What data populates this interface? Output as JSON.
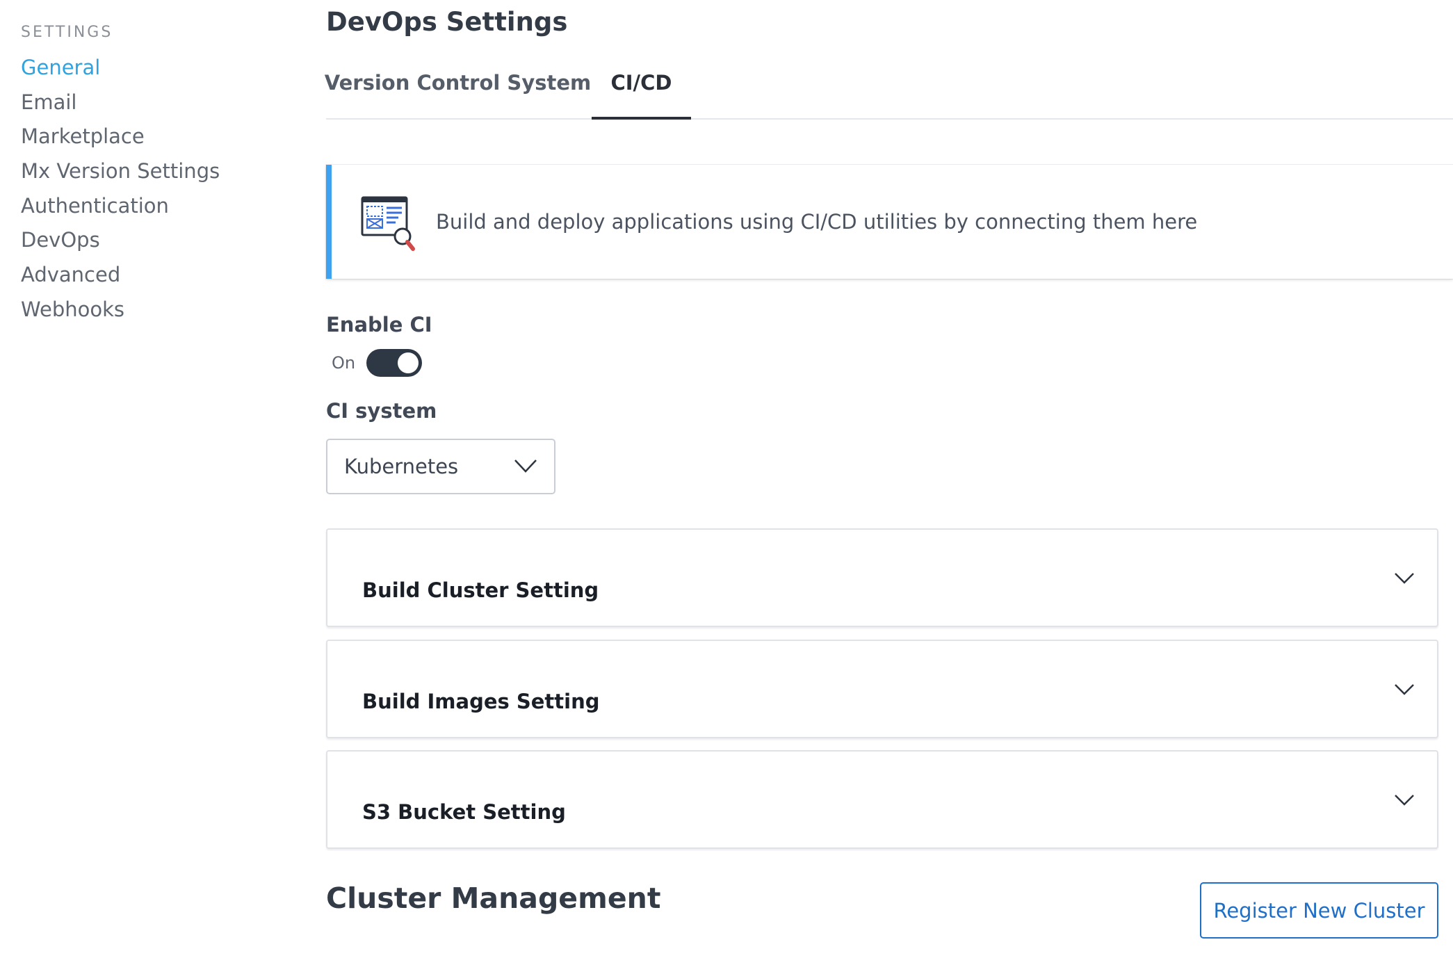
{
  "sidebar": {
    "heading": "SETTINGS",
    "items": [
      {
        "label": "General",
        "active": true
      },
      {
        "label": "Email"
      },
      {
        "label": "Marketplace"
      },
      {
        "label": "Mx Version Settings"
      },
      {
        "label": "Authentication"
      },
      {
        "label": "DevOps"
      },
      {
        "label": "Advanced"
      },
      {
        "label": "Webhooks"
      }
    ]
  },
  "header": {
    "title": "DevOps Settings"
  },
  "tabs": [
    {
      "label": "Version Control System"
    },
    {
      "label": "CI/CD",
      "selected": true
    }
  ],
  "banner": {
    "icon": "document-search-icon",
    "text": "Build and deploy applications using CI/CD utilities by connecting them here"
  },
  "enable_ci": {
    "label": "Enable CI",
    "state_text": "On",
    "on": true
  },
  "ci_system": {
    "label": "CI system",
    "value": "Kubernetes"
  },
  "accordions": [
    {
      "title": "Build Cluster Setting"
    },
    {
      "title": "Build Images Setting"
    },
    {
      "title": "S3 Bucket Setting"
    }
  ],
  "cluster_management": {
    "title": "Cluster Management",
    "register_button": "Register New Cluster"
  },
  "colors": {
    "accent": "#2ea3df",
    "banner_border": "#3fa2f1",
    "toggle_on": "#2e3845",
    "button_blue": "#1f6fc9"
  }
}
